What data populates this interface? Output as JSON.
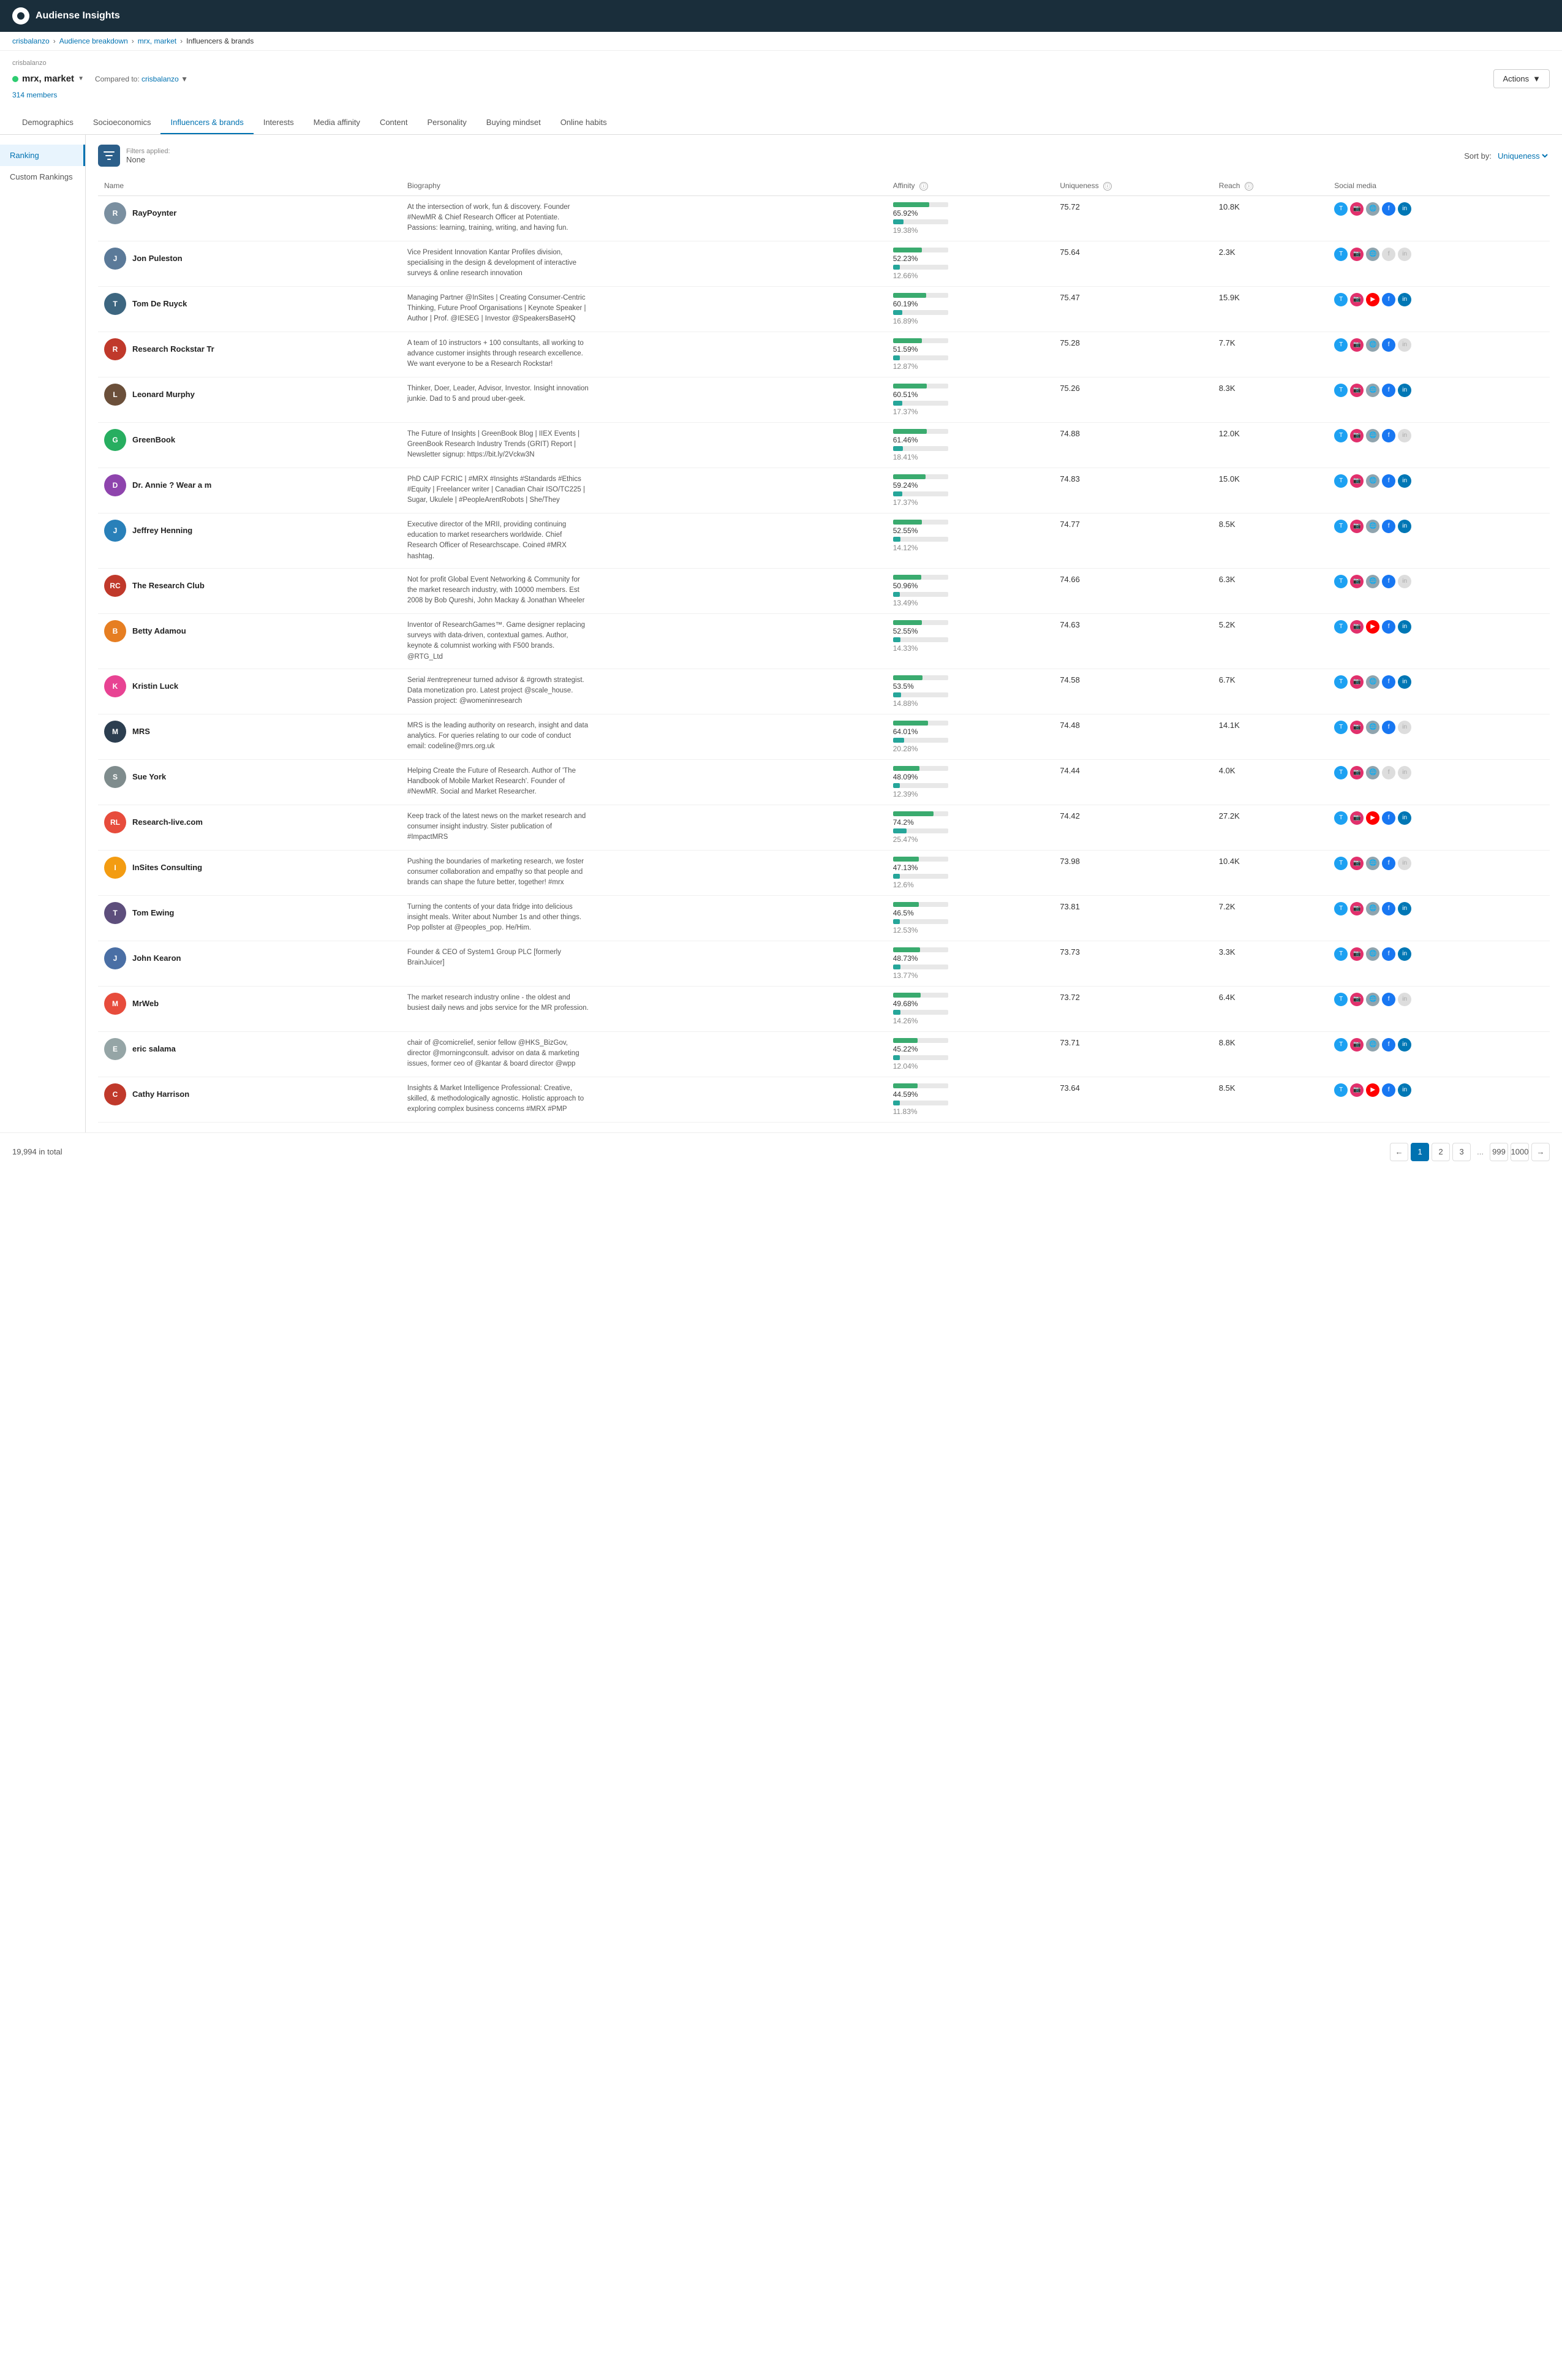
{
  "app": {
    "title": "Audiense Insights"
  },
  "breadcrumb": {
    "items": [
      "crisbalanzo",
      "Audience breakdown",
      "mrx, market",
      "Influencers & brands"
    ]
  },
  "page": {
    "workspace": "crisbalanzo",
    "audience_name": "mrx, market",
    "compared_to": "crisbalanzo",
    "members_count": "314 members",
    "actions_label": "Actions"
  },
  "tabs": [
    {
      "id": "demographics",
      "label": "Demographics"
    },
    {
      "id": "socioeconomics",
      "label": "Socioeconomics"
    },
    {
      "id": "influencers",
      "label": "Influencers & brands",
      "active": true
    },
    {
      "id": "interests",
      "label": "Interests"
    },
    {
      "id": "media-affinity",
      "label": "Media affinity"
    },
    {
      "id": "content",
      "label": "Content"
    },
    {
      "id": "personality",
      "label": "Personality"
    },
    {
      "id": "buying-mindset",
      "label": "Buying mindset"
    },
    {
      "id": "online-habits",
      "label": "Online habits"
    }
  ],
  "sidebar": {
    "items": [
      {
        "id": "ranking",
        "label": "Ranking",
        "active": true
      },
      {
        "id": "custom-rankings",
        "label": "Custom Rankings"
      }
    ]
  },
  "filters": {
    "label": "Filters applied:",
    "value": "None"
  },
  "sort": {
    "label": "Sort by:",
    "value": "Uniqueness"
  },
  "table": {
    "columns": [
      "Name",
      "Biography",
      "Affinity",
      "Uniqueness",
      "Reach",
      "Social media"
    ],
    "rows": [
      {
        "name": "RayPoynter",
        "bio": "At the intersection of work, fun & discovery. Founder #NewMR & Chief Research Officer at Potentiate. Passions: learning, training, writing, and having fun.",
        "affinity_main": "65.92%",
        "affinity_base": "19.38%",
        "affinity_main_pct": 66,
        "affinity_base_pct": 19,
        "uniqueness": "75.72",
        "reach": "10.8K",
        "social": [
          "twitter",
          "instagram",
          "web",
          "facebook",
          "linkedin"
        ],
        "avatar_color": "#7a8fa0",
        "avatar_initials": "R"
      },
      {
        "name": "Jon Puleston",
        "bio": "Vice President Innovation Kantar Profiles division, specialising in the design & development of interactive surveys & online research innovation",
        "affinity_main": "52.23%",
        "affinity_base": "12.66%",
        "affinity_main_pct": 52,
        "affinity_base_pct": 13,
        "uniqueness": "75.64",
        "reach": "2.3K",
        "social": [
          "twitter",
          "instagram",
          "web",
          "facebook-disabled",
          "linkedin-disabled"
        ],
        "avatar_color": "#5b7a99",
        "avatar_initials": "J"
      },
      {
        "name": "Tom De Ruyck",
        "bio": "Managing Partner @InSites | Creating Consumer-Centric Thinking, Future Proof Organisations | Keynote Speaker | Author | Prof. @IESEG | Investor @SpeakersBaseHQ",
        "affinity_main": "60.19%",
        "affinity_base": "16.89%",
        "affinity_main_pct": 60,
        "affinity_base_pct": 17,
        "uniqueness": "75.47",
        "reach": "15.9K",
        "social": [
          "twitter",
          "instagram",
          "youtube",
          "facebook",
          "linkedin"
        ],
        "avatar_color": "#3d6680",
        "avatar_initials": "T"
      },
      {
        "name": "Research Rockstar Tr",
        "bio": "A team of 10 instructors + 100 consultants, all working to advance customer insights through research excellence. We want everyone to be a Research Rockstar!",
        "affinity_main": "51.59%",
        "affinity_base": "12.87%",
        "affinity_main_pct": 52,
        "affinity_base_pct": 13,
        "uniqueness": "75.28",
        "reach": "7.7K",
        "social": [
          "twitter",
          "instagram",
          "web",
          "facebook",
          "linkedin-disabled"
        ],
        "avatar_color": "#c0392b",
        "avatar_initials": "R",
        "is_logo": true,
        "logo_type": "research_rockstar"
      },
      {
        "name": "Leonard Murphy",
        "bio": "Thinker, Doer, Leader, Advisor, Investor. Insight innovation junkie. Dad to 5 and proud uber-geek.",
        "affinity_main": "60.51%",
        "affinity_base": "17.37%",
        "affinity_main_pct": 61,
        "affinity_base_pct": 17,
        "uniqueness": "75.26",
        "reach": "8.3K",
        "social": [
          "twitter",
          "instagram",
          "web",
          "facebook",
          "linkedin"
        ],
        "avatar_color": "#6b4f3a",
        "avatar_initials": "L"
      },
      {
        "name": "GreenBook",
        "bio": "The Future of Insights | GreenBook Blog | IIEX Events | GreenBook Research Industry Trends (GRIT) Report | Newsletter signup: https://bit.ly/2Vckw3N",
        "affinity_main": "61.46%",
        "affinity_base": "18.41%",
        "affinity_main_pct": 61,
        "affinity_base_pct": 18,
        "uniqueness": "74.88",
        "reach": "12.0K",
        "social": [
          "twitter",
          "instagram",
          "web",
          "facebook",
          "linkedin-disabled"
        ],
        "avatar_color": "#27ae60",
        "avatar_initials": "G",
        "is_logo": true,
        "logo_type": "greenbook"
      },
      {
        "name": "Dr. Annie ? Wear a m",
        "bio": "PhD CAIP FCRIC | #MRX #Insights #Standards #Ethics #Equity | Freelancer writer | Canadian Chair ISO/TC225 | Sugar, Ukulele | #PeopleArentRobots | She/They",
        "affinity_main": "59.24%",
        "affinity_base": "17.37%",
        "affinity_main_pct": 59,
        "affinity_base_pct": 17,
        "uniqueness": "74.83",
        "reach": "15.0K",
        "social": [
          "twitter",
          "instagram",
          "web",
          "facebook",
          "linkedin"
        ],
        "avatar_color": "#8e44ad",
        "avatar_initials": "D"
      },
      {
        "name": "Jeffrey Henning",
        "bio": "Executive director of the MRII, providing continuing education to market researchers worldwide. Chief Research Officer of Researchscape. Coined #MRX hashtag.",
        "affinity_main": "52.55%",
        "affinity_base": "14.12%",
        "affinity_main_pct": 53,
        "affinity_base_pct": 14,
        "uniqueness": "74.77",
        "reach": "8.5K",
        "social": [
          "twitter",
          "instagram",
          "web",
          "facebook",
          "linkedin"
        ],
        "avatar_color": "#2980b9",
        "avatar_initials": "J"
      },
      {
        "name": "The Research Club",
        "bio": "Not for profit Global Event Networking & Community for the market research industry, with 10000 members. Est 2008 by Bob Qureshi, John Mackay & Jonathan Wheeler",
        "affinity_main": "50.96%",
        "affinity_base": "13.49%",
        "affinity_main_pct": 51,
        "affinity_base_pct": 13,
        "uniqueness": "74.66",
        "reach": "6.3K",
        "social": [
          "twitter",
          "instagram",
          "web",
          "facebook",
          "linkedin-disabled"
        ],
        "avatar_color": "#c0392b",
        "avatar_initials": "RC",
        "is_logo": true,
        "logo_type": "research_club"
      },
      {
        "name": "Betty Adamou",
        "bio": "Inventor of ResearchGames™. Game designer replacing surveys with data-driven, contextual games. Author, keynote & columnist working with F500 brands. @RTG_Ltd",
        "affinity_main": "52.55%",
        "affinity_base": "14.33%",
        "affinity_main_pct": 53,
        "affinity_base_pct": 14,
        "uniqueness": "74.63",
        "reach": "5.2K",
        "social": [
          "twitter",
          "instagram",
          "youtube",
          "facebook",
          "linkedin"
        ],
        "avatar_color": "#e67e22",
        "avatar_initials": "B"
      },
      {
        "name": "Kristin Luck",
        "bio": "Serial #entrepreneur turned advisor & #growth strategist. Data monetization pro. Latest project @scale_house. Passion project: @womeninresearch",
        "affinity_main": "53.5%",
        "affinity_base": "14.88%",
        "affinity_main_pct": 54,
        "affinity_base_pct": 15,
        "uniqueness": "74.58",
        "reach": "6.7K",
        "social": [
          "twitter",
          "instagram",
          "web",
          "facebook",
          "linkedin"
        ],
        "avatar_color": "#e84393",
        "avatar_initials": "K"
      },
      {
        "name": "MRS",
        "bio": "MRS is the leading authority on research, insight and data analytics. For queries relating to our code of conduct email: codeline@mrs.org.uk",
        "affinity_main": "64.01%",
        "affinity_base": "20.28%",
        "affinity_main_pct": 64,
        "affinity_base_pct": 20,
        "uniqueness": "74.48",
        "reach": "14.1K",
        "social": [
          "twitter",
          "instagram",
          "web",
          "facebook",
          "linkedin-disabled"
        ],
        "avatar_color": "#2c3e50",
        "avatar_initials": "M",
        "is_logo": true,
        "logo_type": "mrs"
      },
      {
        "name": "Sue York",
        "bio": "Helping Create the Future of Research. Author of 'The Handbook of Mobile Market Research'. Founder of #NewMR. Social and Market Researcher.",
        "affinity_main": "48.09%",
        "affinity_base": "12.39%",
        "affinity_main_pct": 48,
        "affinity_base_pct": 12,
        "uniqueness": "74.44",
        "reach": "4.0K",
        "social": [
          "twitter",
          "instagram",
          "web",
          "facebook-disabled",
          "linkedin-disabled"
        ],
        "avatar_color": "#7f8c8d",
        "avatar_initials": "S"
      },
      {
        "name": "Research-live.com",
        "bio": "Keep track of the latest news on the market research and consumer insight industry. Sister publication of #ImpactMRS",
        "affinity_main": "74.2%",
        "affinity_base": "25.47%",
        "affinity_main_pct": 74,
        "affinity_base_pct": 25,
        "uniqueness": "74.42",
        "reach": "27.2K",
        "social": [
          "twitter",
          "instagram",
          "youtube",
          "facebook",
          "linkedin"
        ],
        "avatar_color": "#e74c3c",
        "avatar_initials": "RL",
        "is_logo": true,
        "logo_type": "rl"
      },
      {
        "name": "InSites Consulting",
        "bio": "Pushing the boundaries of marketing research, we foster consumer collaboration and empathy so that people and brands can shape the future better, together! #mrx",
        "affinity_main": "47.13%",
        "affinity_base": "12.6%",
        "affinity_main_pct": 47,
        "affinity_base_pct": 13,
        "uniqueness": "73.98",
        "reach": "10.4K",
        "social": [
          "twitter",
          "instagram",
          "web",
          "facebook",
          "linkedin-disabled"
        ],
        "avatar_color": "#f39c12",
        "avatar_initials": "I",
        "is_logo": true,
        "logo_type": "insites"
      },
      {
        "name": "Tom Ewing",
        "bio": "Turning the contents of your data fridge into delicious insight meals. Writer about Number 1s and other things. Pop pollster at @peoples_pop. He/Him.",
        "affinity_main": "46.5%",
        "affinity_base": "12.53%",
        "affinity_main_pct": 47,
        "affinity_base_pct": 13,
        "uniqueness": "73.81",
        "reach": "7.2K",
        "social": [
          "twitter",
          "instagram",
          "web",
          "facebook",
          "linkedin"
        ],
        "avatar_color": "#5d4e7c",
        "avatar_initials": "T"
      },
      {
        "name": "John Kearon",
        "bio": "Founder & CEO of System1 Group PLC [formerly BrainJuicer]",
        "affinity_main": "48.73%",
        "affinity_base": "13.77%",
        "affinity_main_pct": 49,
        "affinity_base_pct": 14,
        "uniqueness": "73.73",
        "reach": "3.3K",
        "social": [
          "twitter",
          "instagram",
          "web",
          "facebook",
          "linkedin"
        ],
        "avatar_color": "#4a6fa5",
        "avatar_initials": "J"
      },
      {
        "name": "MrWeb",
        "bio": "The market research industry online - the oldest and busiest daily news and jobs service for the MR profession.",
        "affinity_main": "49.68%",
        "affinity_base": "14.26%",
        "affinity_main_pct": 50,
        "affinity_base_pct": 14,
        "uniqueness": "73.72",
        "reach": "6.4K",
        "social": [
          "twitter",
          "instagram",
          "web",
          "facebook",
          "linkedin-disabled"
        ],
        "avatar_color": "#e74c3c",
        "avatar_initials": "M",
        "is_logo": true,
        "logo_type": "mrweb"
      },
      {
        "name": "eric salama",
        "bio": "chair of @comicrelief, senior fellow @HKS_BizGov, director @morningconsult. advisor on data & marketing issues, former ceo of @kantar & board director @wpp",
        "affinity_main": "45.22%",
        "affinity_base": "12.04%",
        "affinity_main_pct": 45,
        "affinity_base_pct": 12,
        "uniqueness": "73.71",
        "reach": "8.8K",
        "social": [
          "twitter",
          "instagram",
          "web",
          "facebook",
          "linkedin"
        ],
        "avatar_color": "#95a5a6",
        "avatar_initials": "E"
      },
      {
        "name": "Cathy Harrison",
        "bio": "Insights & Market Intelligence Professional: Creative, skilled, & methodologically agnostic. Holistic approach to exploring complex business concerns #MRX #PMP",
        "affinity_main": "44.59%",
        "affinity_base": "11.83%",
        "affinity_main_pct": 45,
        "affinity_base_pct": 12,
        "uniqueness": "73.64",
        "reach": "8.5K",
        "social": [
          "twitter",
          "instagram",
          "youtube",
          "facebook",
          "linkedin"
        ],
        "avatar_color": "#c0392b",
        "avatar_initials": "C"
      }
    ]
  },
  "pagination": {
    "total": "19,994 in total",
    "pages": [
      "1",
      "2",
      "3",
      "999",
      "1000"
    ],
    "current": "1"
  }
}
